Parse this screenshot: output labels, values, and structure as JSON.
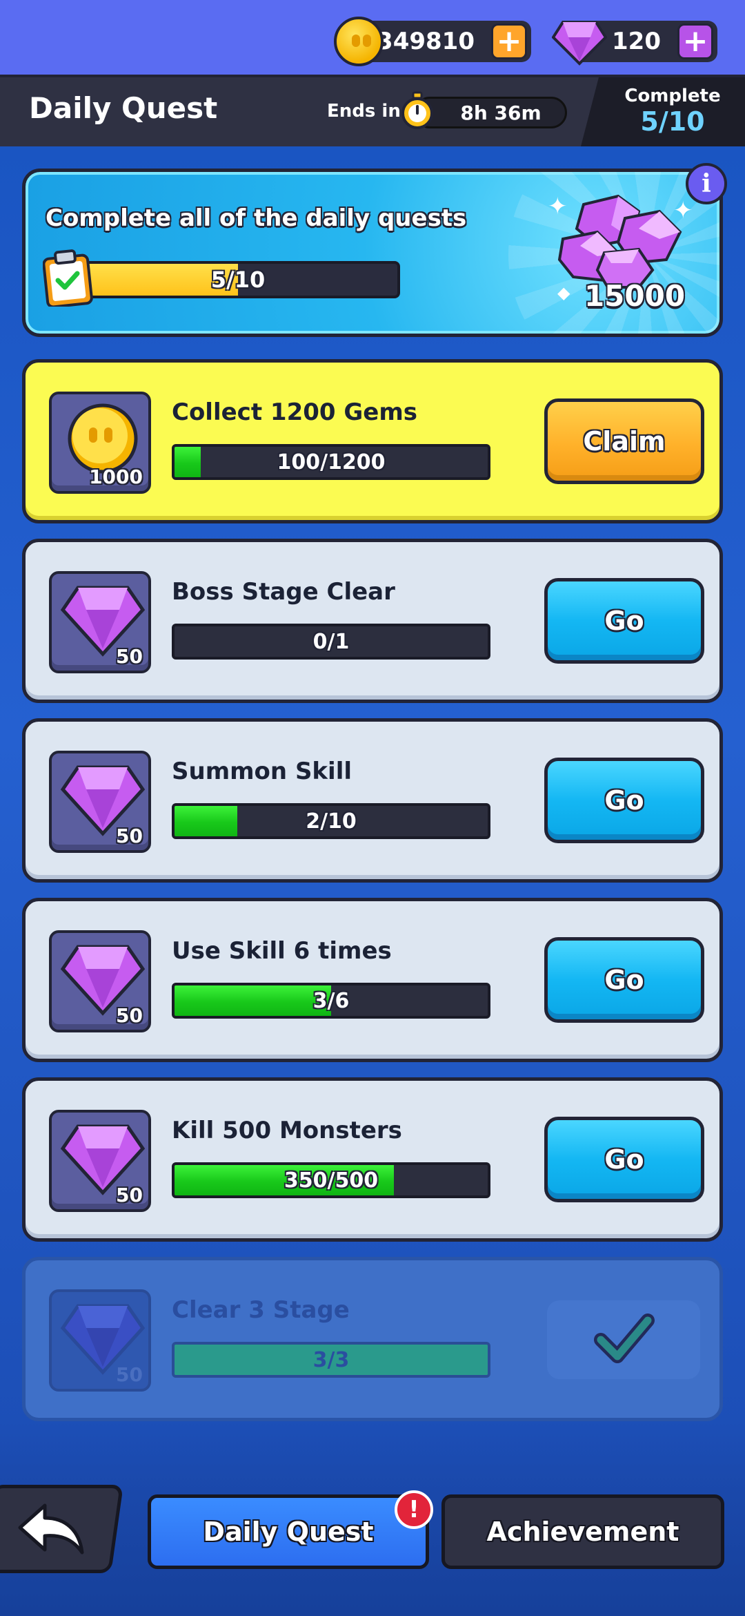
{
  "currency": {
    "coins": "349810",
    "gems": "120"
  },
  "header": {
    "title": "Daily Quest",
    "ends_in_label": "Ends in",
    "timer": "8h 36m",
    "complete_label": "Complete",
    "complete_value": "5/10"
  },
  "banner": {
    "text": "Complete all of the daily quests",
    "progress_text": "5/10",
    "progress_fraction": 0.5,
    "reward_amount": "15000"
  },
  "quests": [
    {
      "title": "Collect 1200 Gems",
      "reward_type": "coin-icon",
      "reward_qty": "1000",
      "progress_text": "100/1200",
      "progress_fraction": 0.0833,
      "action": "Claim",
      "state": "claimable"
    },
    {
      "title": "Boss Stage Clear",
      "reward_type": "gem-icon",
      "reward_qty": "50",
      "progress_text": "0/1",
      "progress_fraction": 0,
      "action": "Go",
      "state": "in-progress"
    },
    {
      "title": "Summon Skill",
      "reward_type": "gem-icon",
      "reward_qty": "50",
      "progress_text": "2/10",
      "progress_fraction": 0.2,
      "action": "Go",
      "state": "in-progress"
    },
    {
      "title": "Use Skill 6 times",
      "reward_type": "gem-icon",
      "reward_qty": "50",
      "progress_text": "3/6",
      "progress_fraction": 0.5,
      "action": "Go",
      "state": "in-progress"
    },
    {
      "title": "Kill 500 Monsters",
      "reward_type": "gem-icon",
      "reward_qty": "50",
      "progress_text": "350/500",
      "progress_fraction": 0.7,
      "action": "Go",
      "state": "in-progress"
    },
    {
      "title": "Clear 3 Stage",
      "reward_type": "gem-icon",
      "reward_qty": "50",
      "progress_text": "3/3",
      "progress_fraction": 1,
      "action": "",
      "state": "completed"
    }
  ],
  "bottom_nav": {
    "daily_tab": "Daily Quest",
    "achievement_tab": "Achievement",
    "alert_badge": "!"
  },
  "colors": {
    "background": "#1d4fb4",
    "top_bar": "#5a6cf2",
    "progress_green": "#18c81a",
    "progress_yellow": "#ffc21a",
    "go_button": "#14b7f3",
    "claim_button": "#ffb12a",
    "highlight_card": "#fbfb52",
    "complete_value": "#6fd2ff"
  }
}
